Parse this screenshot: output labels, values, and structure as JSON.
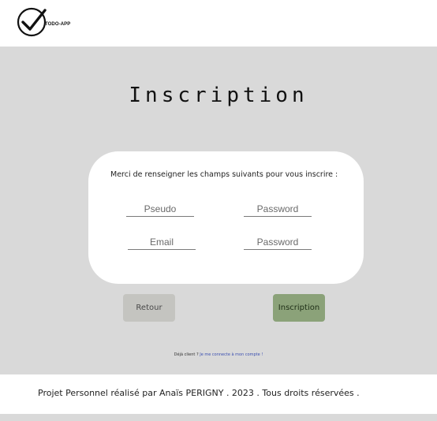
{
  "header": {
    "logo_text": "TODO-APP",
    "logo_icon": "checkmark-circle-icon"
  },
  "main": {
    "title": "Inscription",
    "form": {
      "instructions": "Merci de renseigner les champs suivants pour vous inscrire :",
      "pseudo_placeholder": "Pseudo",
      "password_placeholder": "Password",
      "email_placeholder": "Email",
      "password_confirm_placeholder": "Password"
    },
    "buttons": {
      "back_label": "Retour",
      "register_label": "Inscription"
    },
    "already_client": {
      "text": "Déjà client ? ",
      "link_text": "Je me connecte à mon compte !"
    }
  },
  "footer": {
    "text": "Projet Personnel réalisé par Anaïs PERIGNY . 2023 . Tous droits réservées ."
  },
  "colors": {
    "background": "#d9d9d9",
    "card": "#ffffff",
    "back_button": "#c4c4c0",
    "register_button": "#8ba279",
    "link": "#3b4fb0"
  }
}
